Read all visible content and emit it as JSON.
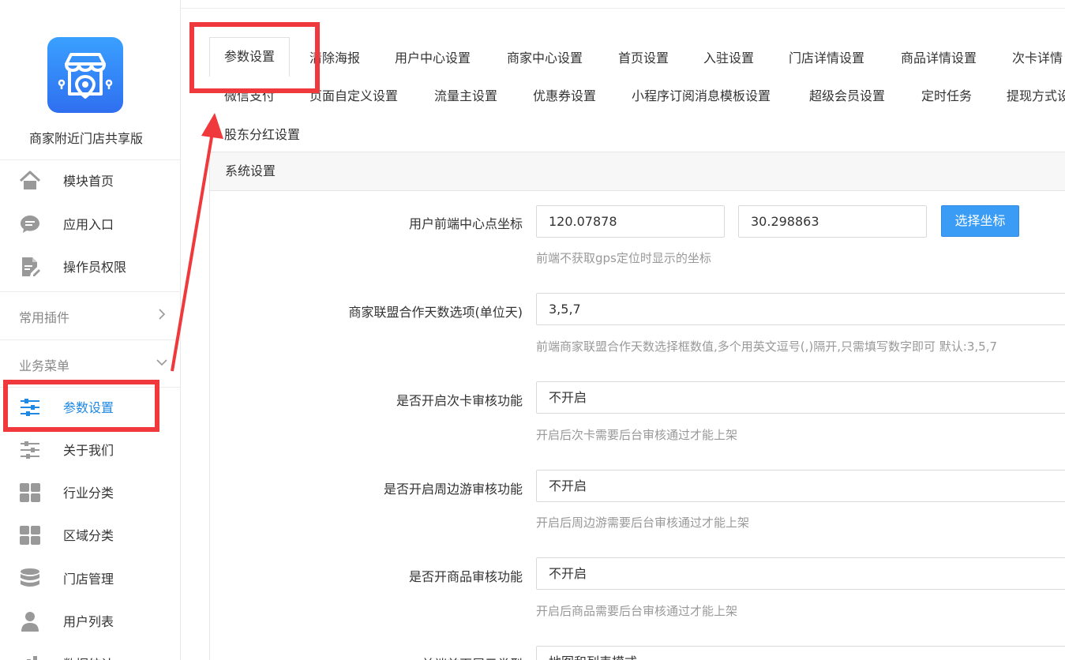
{
  "app": {
    "name": "商家附近门店共享版"
  },
  "sidebar": {
    "top_items": [
      {
        "label": "模块首页",
        "icon": "home-icon"
      },
      {
        "label": "应用入口",
        "icon": "chat-icon"
      },
      {
        "label": "操作员权限",
        "icon": "document-edit-icon"
      }
    ],
    "groups": [
      {
        "label": "常用插件",
        "state": "collapsed"
      },
      {
        "label": "业务菜单",
        "state": "expanded"
      }
    ],
    "menu_items": [
      {
        "label": "参数设置",
        "icon": "sliders-icon",
        "active": true
      },
      {
        "label": "关于我们",
        "icon": "sliders-icon"
      },
      {
        "label": "行业分类",
        "icon": "grid-icon"
      },
      {
        "label": "区域分类",
        "icon": "grid-icon"
      },
      {
        "label": "门店管理",
        "icon": "database-icon"
      },
      {
        "label": "用户列表",
        "icon": "user-icon"
      },
      {
        "label": "数据统计",
        "icon": "chart-icon"
      }
    ]
  },
  "tabs": {
    "row1": [
      "参数设置",
      "清除海报",
      "用户中心设置",
      "商家中心设置",
      "首页设置",
      "入驻设置",
      "门店详情设置",
      "商品详情设置",
      "次卡详情"
    ],
    "row2": [
      "微信支付",
      "页面自定义设置",
      "流量主设置",
      "优惠券设置",
      "小程序订阅消息模板设置",
      "超级会员设置",
      "定时任务",
      "提现方式设"
    ],
    "row3": [
      "股东分红设置"
    ]
  },
  "section": {
    "title": "系统设置"
  },
  "form": {
    "center_coord": {
      "label": "用户前端中心点坐标",
      "lng": "120.07878",
      "lat": "30.298863",
      "button": "选择坐标",
      "help": "前端不获取gps定位时显示的坐标"
    },
    "days_options": {
      "label": "商家联盟合作天数选项(单位天)",
      "value": "3,5,7",
      "help": "前端商家联盟合作天数选择框数值,多个用英文逗号(,)隔开,只需填写数字即可 默认:3,5,7"
    },
    "card_review": {
      "label": "是否开启次卡审核功能",
      "value": "不开启",
      "help": "开启后次卡需要后台审核通过才能上架"
    },
    "tour_review": {
      "label": "是否开启周边游审核功能",
      "value": "不开启",
      "help": "开启后周边游需要后台审核通过才能上架"
    },
    "goods_review": {
      "label": "是否开商品审核功能",
      "value": "不开启",
      "help": "开启后商品需要后台审核通过才能上架"
    },
    "home_display": {
      "label": "前端首页展示类型",
      "value": "地图和列表模式"
    }
  },
  "colors": {
    "primary": "#3a9cf5",
    "active_text": "#1e88e5",
    "annotation": "#f0393c"
  }
}
